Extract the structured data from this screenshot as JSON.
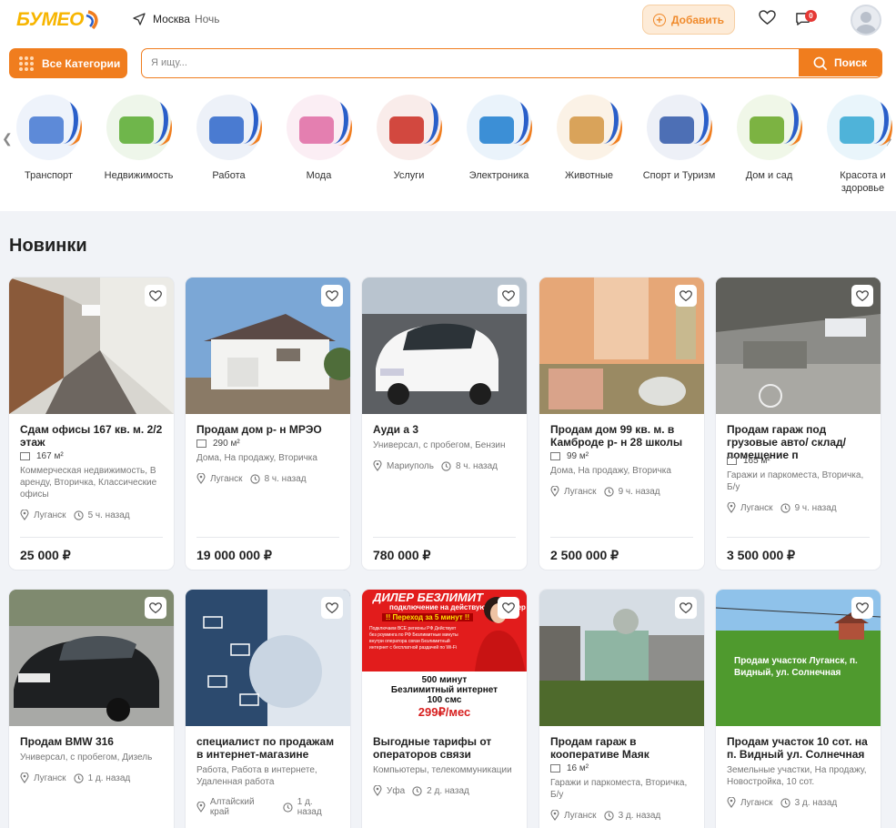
{
  "header": {
    "logo": "БУМЕО",
    "city": "Москва",
    "theme": "Ночь",
    "add_label": "Добавить",
    "chat_count": "0",
    "categories_label": "Все Категории",
    "search_placeholder": "Я ищу...",
    "search_label": "Поиск"
  },
  "categories": [
    {
      "label": "Транспорт",
      "color": "#5d8ad8",
      "icon": "truck-icon"
    },
    {
      "label": "Недвижимость",
      "color": "#6fb64b",
      "icon": "house-icon"
    },
    {
      "label": "Работа",
      "color": "#4a7bd1",
      "icon": "job-icon"
    },
    {
      "label": "Мода",
      "color": "#e47fb0",
      "icon": "fashion-icon"
    },
    {
      "label": "Услуги",
      "color": "#d2483f",
      "icon": "tools-icon"
    },
    {
      "label": "Электроника",
      "color": "#3c8fd6",
      "icon": "laptop-icon"
    },
    {
      "label": "Животные",
      "color": "#d9a35a",
      "icon": "dog-icon"
    },
    {
      "label": "Спорт и Туризм",
      "color": "#4d6fb5",
      "icon": "sport-icon"
    },
    {
      "label": "Дом и сад",
      "color": "#7cb342",
      "icon": "garden-icon"
    },
    {
      "label": "Красота и здоровье",
      "color": "#4fb3d9",
      "icon": "beauty-icon"
    }
  ],
  "section_title": "Новинки",
  "listings": [
    {
      "title": "Сдам офисы 167 кв. м. 2/2 этаж",
      "area": "167 м²",
      "meta": "Коммерческая недвижимость, В аренду, Вторичка, Классические офисы",
      "city": "Луганск",
      "time": "5 ч. назад",
      "price": "25 000 ₽"
    },
    {
      "title": "Продам дом р- н МРЭО",
      "area": "290 м²",
      "meta": "Дома, На продажу, Вторичка",
      "city": "Луганск",
      "time": "8 ч. назад",
      "price": "19 000 000 ₽"
    },
    {
      "title": "Ауди а 3",
      "area": "",
      "meta": "Универсал, с пробегом, Бензин",
      "city": "Мариуполь",
      "time": "8 ч. назад",
      "price": "780 000 ₽"
    },
    {
      "title": "Продам дом 99 кв. м. в Камброде р- н 28 школы",
      "area": "99 м²",
      "meta": "Дома, На продажу, Вторичка",
      "city": "Луганск",
      "time": "9 ч. назад",
      "price": "2 500 000 ₽"
    },
    {
      "title": "Продам гараж под грузовые авто/ склад/ помещение п",
      "area": "165 м²",
      "meta": "Гаражи и паркоместа, Вторичка, Б/у",
      "city": "Луганск",
      "time": "9 ч. назад",
      "price": "3 500 000 ₽"
    },
    {
      "title": "Продам BMW 316",
      "area": "",
      "meta": "Универсал, с пробегом, Дизель",
      "city": "Луганск",
      "time": "1 д. назад",
      "price": ""
    },
    {
      "title": "специалист по продажам в интернет-магазине",
      "area": "",
      "meta": "Работа, Работа в интернете, Удаленная работа",
      "city": "Алтайский край",
      "time": "1 д. назад",
      "price": ""
    },
    {
      "title": "Выгодные тарифы от операторов связи",
      "area": "",
      "meta": "Компьютеры, телекоммуникации",
      "city": "Уфа",
      "time": "2 д. назад",
      "price": ""
    },
    {
      "title": "Продам гараж в кооперативе Маяк",
      "area": "16 м²",
      "meta": "Гаражи и паркоместа, Вторичка, Б/у",
      "city": "Луганск",
      "time": "3 д. назад",
      "price": ""
    },
    {
      "title": "Продам участок 10 сот. на п. Видный ул. Солнечная",
      "area": "",
      "meta": "Земельные участки, На продажу, Новостройка, 10 сот.",
      "city": "Луганск",
      "time": "3 д. назад",
      "price": ""
    }
  ],
  "promo": {
    "head": "ДИЛЕР БЕЗЛИМИТ",
    "sub": "подключение на действующий номер",
    "badge": "!! Переход за 5 минут !!",
    "small": "Подключаем ВСЕ регионы РФ Действует без роуминга по РФ Безлимитные минуты внутри оператора связи Безлимитный интернет с бесплатной раздачей по Wi-Fi",
    "minutes": "500 минут",
    "internet": "Безлимитный интернет",
    "sms": "100 смс",
    "price": "299₽/мес"
  },
  "plot_caption": "Продам участок Луганск, п. Видный, ул. Солнечная"
}
